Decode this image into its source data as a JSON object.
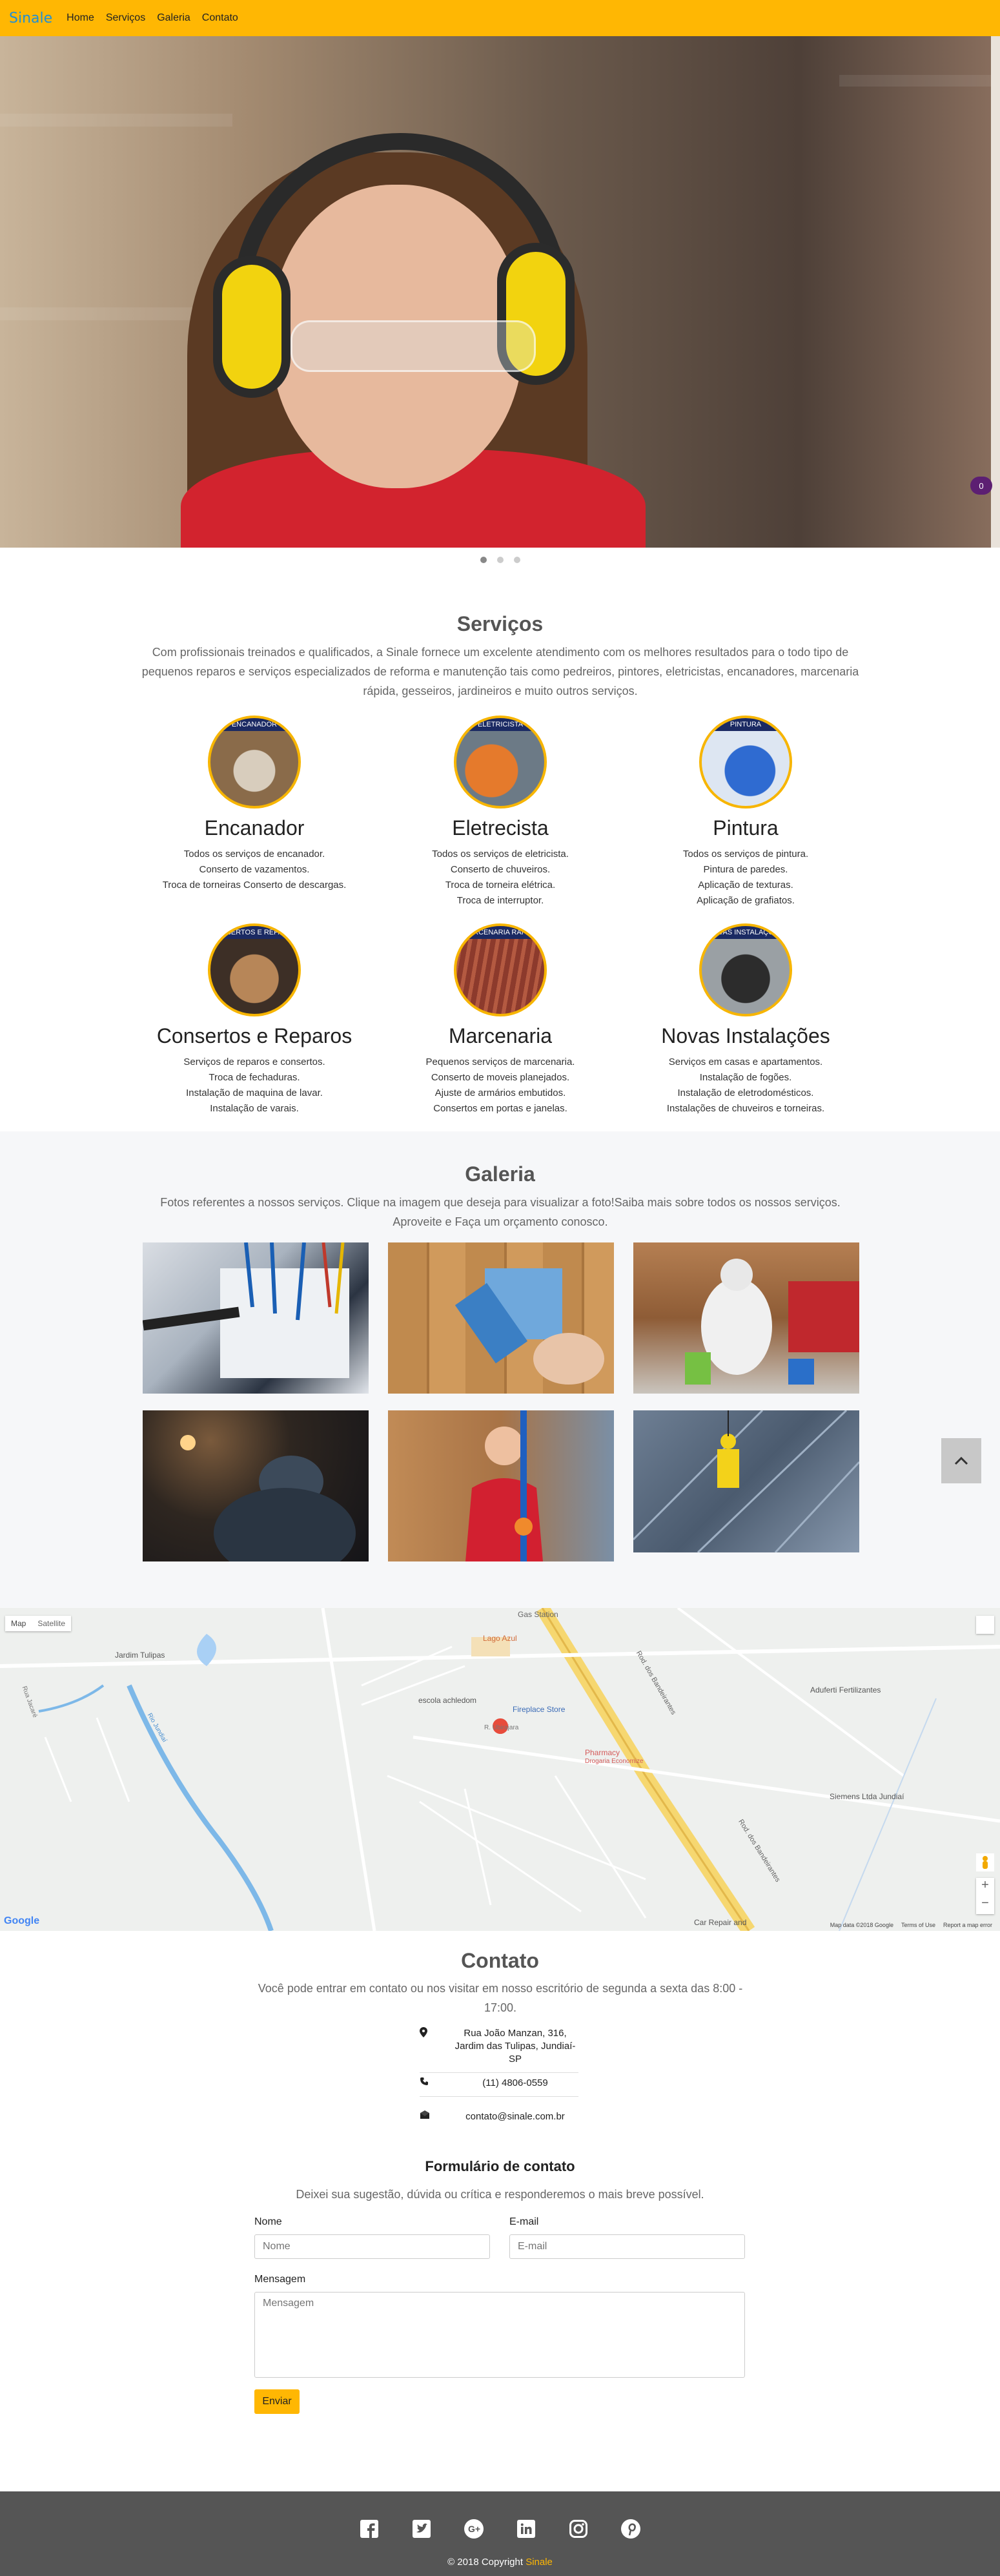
{
  "nav": {
    "brand": "Sinale",
    "links": [
      "Home",
      "Serviços",
      "Galeria",
      "Contato"
    ]
  },
  "hero": {
    "cart_count": "0",
    "slide_count": 3,
    "active_slide": 1
  },
  "services": {
    "title": "Serviços",
    "lead": "Com profissionais treinados e qualificados, a Sinale fornece um excelente atendimento com os melhores resultados para o todo tipo de pequenos reparos e serviços especializados de reforma e manutenção tais como pedreiros, pintores, eletricistas, encanadores, marcenaria rápida, gesseiros, jardineiros e muito outros serviços.",
    "items": [
      {
        "badge": "ENCANADOR",
        "title": "Encanador",
        "lines": [
          "Todos os serviços de encanador.",
          "Conserto de vazamentos.",
          "Troca de torneiras Conserto de descargas."
        ]
      },
      {
        "badge": "ELETRICISTA",
        "title": "Eletrecista",
        "lines": [
          "Todos os serviços de eletricista.",
          "Conserto de chuveiros.",
          "Troca de torneira elétrica.",
          "Troca de interruptor."
        ]
      },
      {
        "badge": "PINTURA",
        "title": "Pintura",
        "lines": [
          "Todos os serviços de pintura.",
          "Pintura de paredes.",
          "Aplicação de texturas.",
          "Aplicação de grafiatos."
        ]
      },
      {
        "badge": "CONSERTOS E REPAROS",
        "title": "Consertos e Reparos",
        "lines": [
          "Serviços de reparos e consertos.",
          "Troca de fechaduras.",
          "Instalação de maquina de lavar.",
          "Instalação de varais."
        ]
      },
      {
        "badge": "MARCENARIA RÁPIDA",
        "title": "Marcenaria",
        "lines": [
          "Pequenos serviços de marcenaria.",
          "Conserto de moveis planejados.",
          "Ajuste de armários embutidos.",
          "Consertos em portas e janelas."
        ]
      },
      {
        "badge": "NOVAS INSTALAÇÕES",
        "title": "Novas Instalações",
        "lines": [
          "Serviços em casas e apartamentos.",
          "Instalação de fogões.",
          "Instalação de eletrodomésticos.",
          "Instalações de chuveiros e torneiras."
        ]
      }
    ]
  },
  "gallery": {
    "title": "Galeria",
    "lead": "Fotos referentes a nossos serviços. Clique na imagem que deseja para visualizar a foto!Saiba mais sobre todos os nossos serviços. Aproveite e Faça um orçamento conosco."
  },
  "map": {
    "tabs": [
      "Map",
      "Satellite"
    ],
    "labels": [
      "Gas Station",
      "Lago Azul",
      "Jardim Tulipas",
      "escola achledom",
      "Fireplace Store",
      "R. Ubirajara",
      "Pharmacy",
      "Drogaria Economize",
      "Aduferti Fertilizantes",
      "Siemens Ltda Jundiaí",
      "Rod. dos Bandeirantes",
      "Rod. dos Bandeirantes",
      "Car Repair and",
      "Rua Jacaré",
      "Rio Jundiaí",
      "Google"
    ],
    "footer": [
      "Map data ©2018 Google",
      "Terms of Use",
      "Report a map error"
    ]
  },
  "contact": {
    "title": "Contato",
    "lead": "Você pode entrar em contato ou nos visitar em nosso escritório de segunda a sexta das 8:00 - 17:00.",
    "address": "Rua João Manzan, 316, Jardim das Tulipas, Jundiaí-SP",
    "phone": "(11) 4806-0559",
    "email": "contato@sinale.com.br"
  },
  "form": {
    "title": "Formulário de contato",
    "lead": "Deixei sua sugestão, dúvida ou crítica e responderemos o mais breve possível.",
    "name_label": "Nome",
    "name_placeholder": "Nome",
    "email_label": "E-mail",
    "email_placeholder": "E-mail",
    "message_label": "Mensagem",
    "message_placeholder": "Mensagem",
    "submit": "Enviar"
  },
  "footer": {
    "social": [
      "facebook-icon",
      "twitter-icon",
      "google-plus-icon",
      "linkedin-icon",
      "instagram-icon",
      "pinterest-icon"
    ],
    "copy_prefix": "© 2018 Copyright ",
    "copy_brand": "Sinale"
  },
  "colors": {
    "accent": "#ffb703",
    "brand": "#1f8fd6",
    "footer": "#555555"
  }
}
